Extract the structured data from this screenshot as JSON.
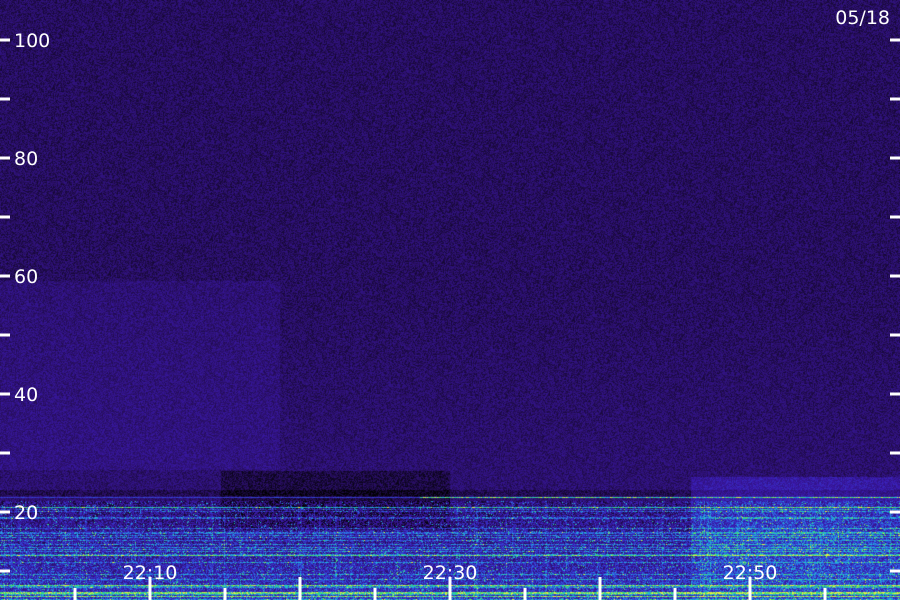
{
  "chart_data": {
    "type": "heatmap",
    "title": "",
    "date_label": "05/18",
    "xlabel": "",
    "ylabel": "",
    "x_tick_labels": [
      "22:10",
      "22:30",
      "22:50"
    ],
    "x_range": [
      "22:00",
      "23:00"
    ],
    "x_major_tick_minutes": 5,
    "y_tick_labels": [
      "20",
      "40",
      "60",
      "80",
      "100"
    ],
    "y_range": [
      0,
      100
    ],
    "y_minor_tick_step": 10,
    "grid": false,
    "colormap": [
      "#000000",
      "#2a0f66",
      "#3b1ab0",
      "#2f55e0",
      "#20c0e0",
      "#40e060",
      "#f0f040"
    ],
    "background_level_color": "#2a0f66",
    "features": {
      "strong_band_top_value": 22,
      "line_at_value": 22.5,
      "line_starts_minute": 28,
      "enhanced_patch_minutes": [
        46,
        60
      ],
      "enhanced_patch_max_value": 26
    }
  }
}
